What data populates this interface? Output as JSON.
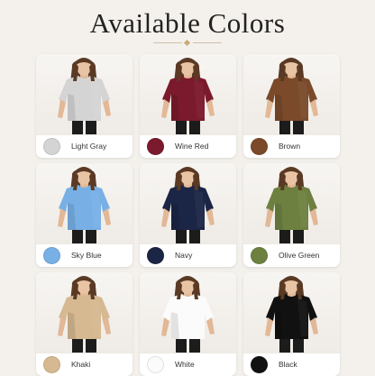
{
  "header": {
    "title": "Available Colors"
  },
  "colors": [
    {
      "name": "Light Gray",
      "hex": "#d4d4d4"
    },
    {
      "name": "Wine Red",
      "hex": "#7b1a2c"
    },
    {
      "name": "Brown",
      "hex": "#7a4a2a"
    },
    {
      "name": "Sky Blue",
      "hex": "#78b0e6"
    },
    {
      "name": "Navy",
      "hex": "#1b2545"
    },
    {
      "name": "Olive Green",
      "hex": "#6d8040"
    },
    {
      "name": "Khaki",
      "hex": "#d6b991"
    },
    {
      "name": "White",
      "hex": "#fbfbfb"
    },
    {
      "name": "Black",
      "hex": "#111111"
    }
  ]
}
